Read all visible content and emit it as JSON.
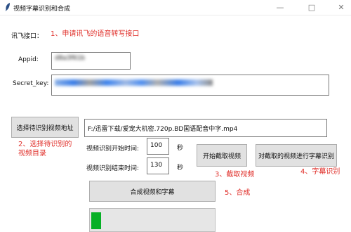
{
  "window": {
    "title": "视频字幕识别和合成",
    "minimize_glyph": "—",
    "maximize_glyph": "□",
    "close_glyph": "✕"
  },
  "header": {
    "label": "讯飞接口：",
    "note": "1、申请讯飞的语音转写接口"
  },
  "appid": {
    "label": "Appid:",
    "value": "d8a3f61b"
  },
  "secret_key": {
    "label": "Secret_key:",
    "value": "5c1e8a3f0d9b2c7e44a1f6b8e2d0c9a7"
  },
  "select_video": {
    "button_label": "选择待识别视频地址",
    "path_value": "F:/迅雷下载/爱宠大机密.720p.BD国语配音中字.mp4",
    "note_line1": "2、选择待识别的",
    "note_line2": "视频目录"
  },
  "start_time": {
    "label": "视频识别开始时间:",
    "value": "100",
    "unit": "秒"
  },
  "end_time": {
    "label": "视频识别结束时间:",
    "value": "130",
    "unit": "秒"
  },
  "capture": {
    "button_label": "开始截取视频",
    "note": "3、截取视频"
  },
  "recognize": {
    "button_label": "对截取的视频进行字幕识别",
    "note": "4、字幕识别"
  },
  "merge": {
    "button_label": "合成视频和字幕",
    "note": "5、合成"
  },
  "progress": {
    "value": 0.08
  },
  "colors": {
    "annotation": "#e0302b",
    "progress_fill": "#06b025"
  },
  "icons": {
    "app": "feather-icon"
  }
}
